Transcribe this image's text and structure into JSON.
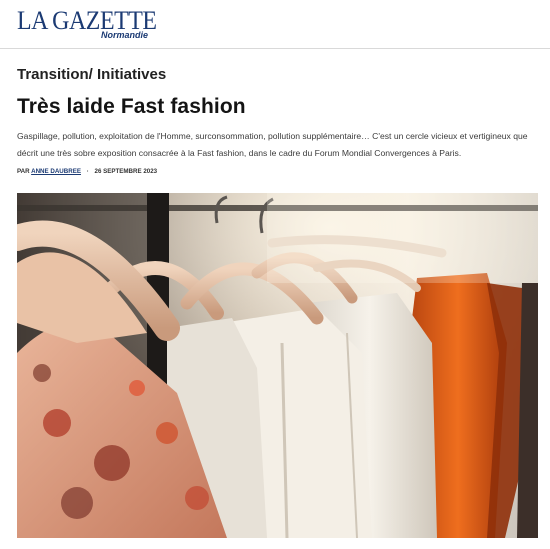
{
  "masthead": {
    "logo_main": "LA GAZETTE",
    "logo_sub": "Normandie"
  },
  "article": {
    "rubric": "Transition/ Initiatives",
    "headline": "Très laide Fast fashion",
    "lede": "Gaspillage, pollution, exploitation de l'Homme, surconsommation, pollution supplémentaire… C'est un cercle vicieux et vertigineux que décrit une très sobre exposition consacrée à la Fast fashion, dans le cadre du Forum Mondial Convergences à Paris.",
    "byline_prefix": "PAR",
    "author": "ANNE DAUBREE",
    "date": "26 SEPTEMBRE 2023"
  },
  "photo": {
    "subject": "clothes-on-hangers"
  },
  "colors": {
    "brand": "#1b3a73",
    "text": "#1c1c1c"
  }
}
